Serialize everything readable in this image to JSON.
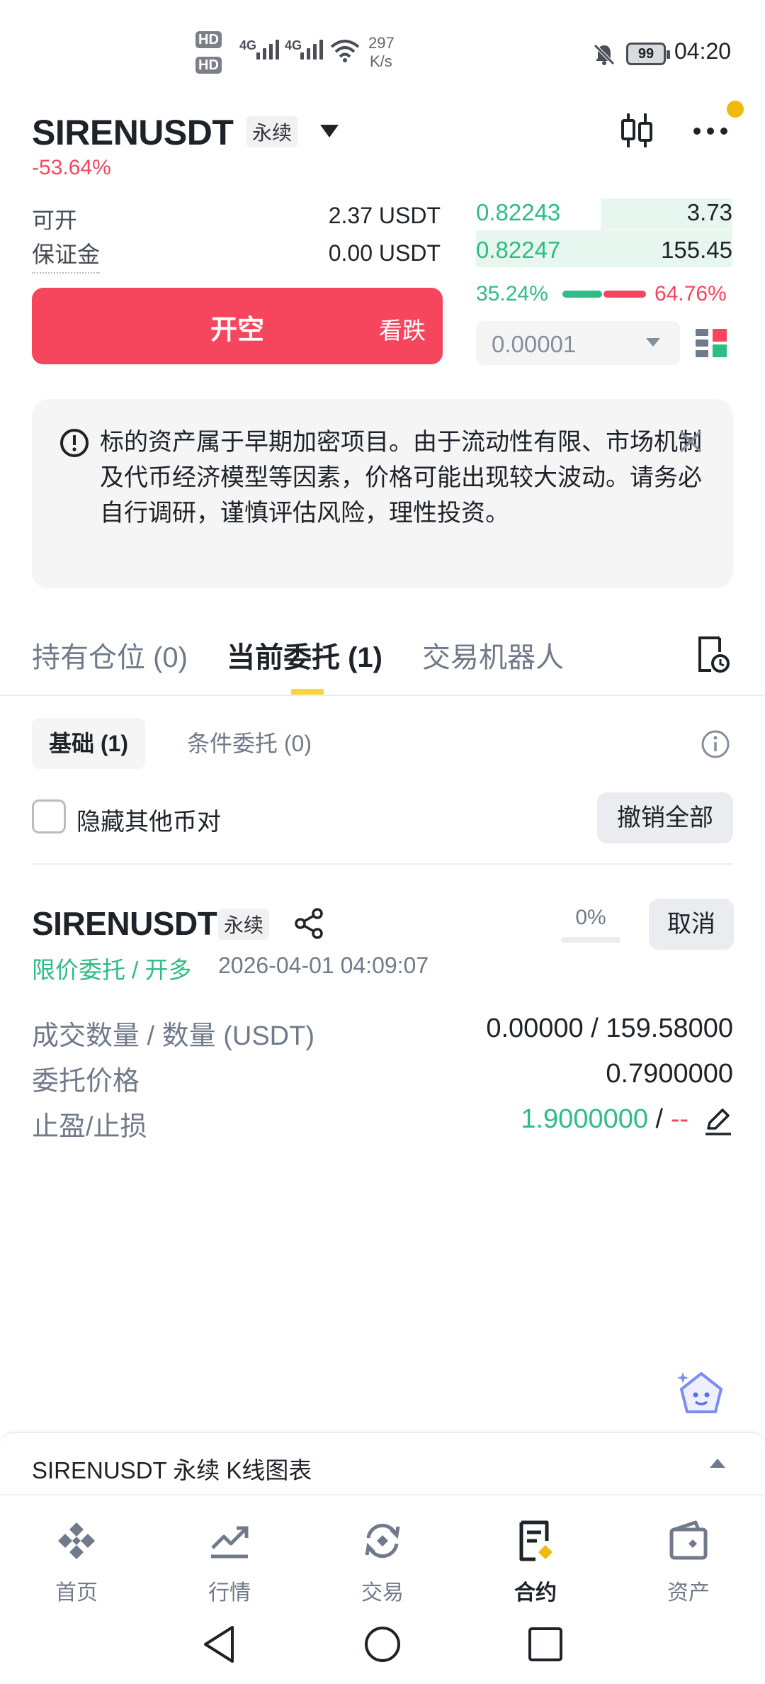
{
  "status_bar": {
    "hd1": "HD",
    "hd2": "HD",
    "net1": "4G",
    "net2": "4G",
    "speed_value": "297",
    "speed_unit": "K/s",
    "battery": "99",
    "time": "04:20"
  },
  "header": {
    "symbol": "SIRENUSDT",
    "contract_type": "永续",
    "change_pct": "-53.64%"
  },
  "order_panel": {
    "available_label": "可开",
    "available_value": "2.37 USDT",
    "margin_label": "保证金",
    "margin_value": "0.00 USDT",
    "short_button": "开空",
    "short_button_sub": "看跌"
  },
  "order_book": {
    "rows": [
      {
        "price": "0.82243",
        "qty": "3.73"
      },
      {
        "price": "0.82247",
        "qty": "155.45"
      }
    ],
    "buy_ratio": "35.24%",
    "sell_ratio": "64.76%",
    "precision": "0.00001"
  },
  "notice": {
    "text": "标的资产属于早期加密项目。由于流动性有限、市场机制及代币经济模型等因素，价格可能出现较大波动。请务必自行调研，谨慎评估风险，理性投资。"
  },
  "tabs": [
    {
      "label": "持有仓位 (0)"
    },
    {
      "label": "当前委托 (1)"
    },
    {
      "label": "交易机器人"
    }
  ],
  "subtabs": [
    {
      "label": "基础 (1)"
    },
    {
      "label": "条件委托 (0)"
    }
  ],
  "filter": {
    "hide_other_pairs": "隐藏其他币对",
    "cancel_all": "撤销全部"
  },
  "order": {
    "symbol": "SIRENUSDT",
    "contract_type": "永续",
    "fill_pct": "0%",
    "cancel": "取消",
    "type": "限价委托 / 开多",
    "time": "2026-04-01 04:09:07",
    "qty_label": "成交数量 / 数量 (USDT)",
    "qty_value": "0.00000 / 159.58000",
    "price_label": "委托价格",
    "price_value": "0.7900000",
    "tpsl_label": "止盈/止损",
    "tp_value": "1.9000000",
    "tpsl_sep": " / ",
    "sl_value": "--"
  },
  "chart_bar": {
    "label": "SIRENUSDT 永续 K线图表"
  },
  "bottom_nav": [
    {
      "label": "首页",
      "icon": "home-icon"
    },
    {
      "label": "行情",
      "icon": "markets-icon"
    },
    {
      "label": "交易",
      "icon": "trade-icon"
    },
    {
      "label": "合约",
      "icon": "futures-icon"
    },
    {
      "label": "资产",
      "icon": "assets-icon"
    }
  ],
  "colors": {
    "brand_yellow": "#fcd535",
    "buy_green": "#2ebd85",
    "sell_red": "#f6465d"
  }
}
